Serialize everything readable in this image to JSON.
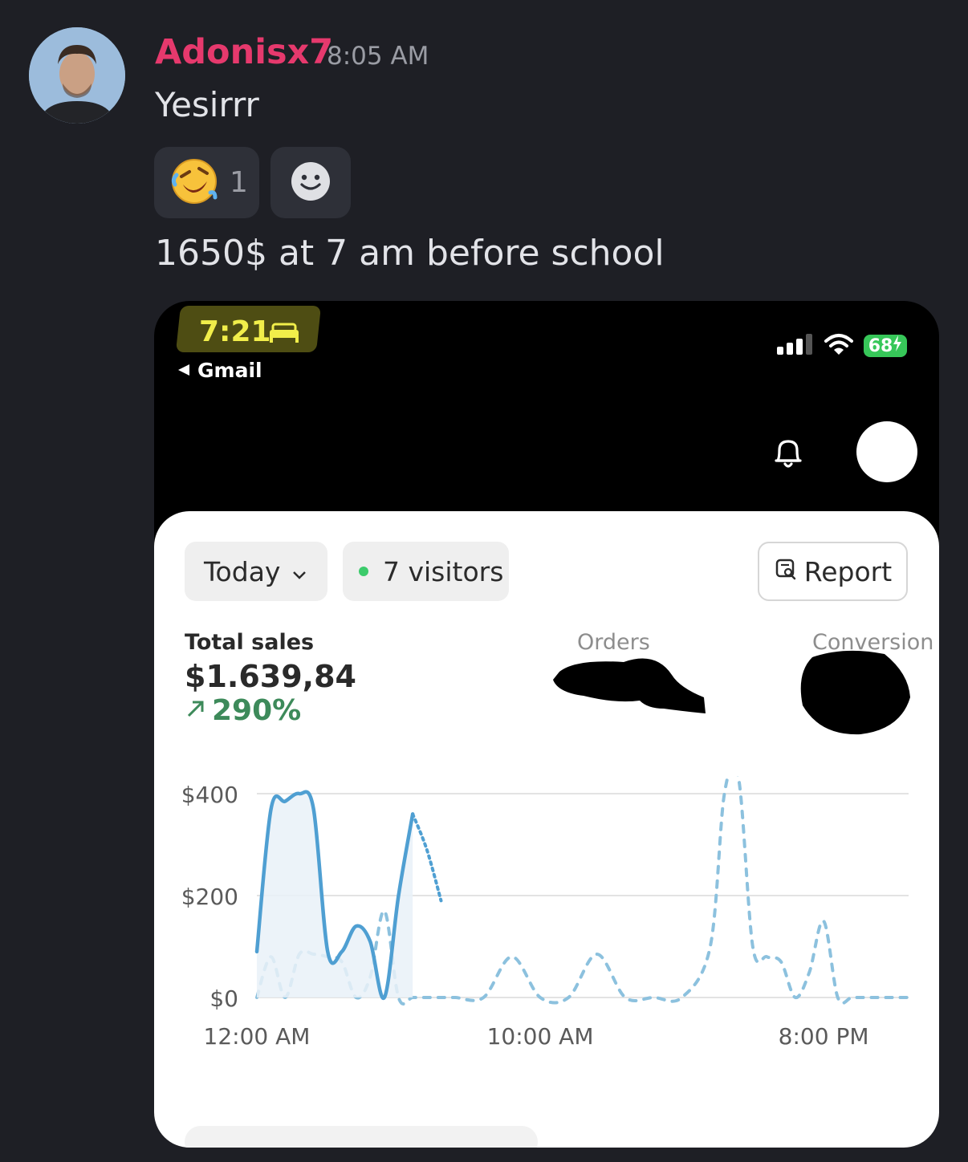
{
  "message": {
    "username": "Adonisx7",
    "timestamp": "8:05 AM",
    "text1": "Yesirrr",
    "reaction": {
      "emoji": "🤣",
      "count": "1"
    },
    "text2": "1650$ at 7 am before school"
  },
  "phone": {
    "time": "7:21",
    "back_label": "Gmail",
    "battery": "68"
  },
  "dashboard": {
    "period": "Today",
    "visitors": "7 visitors",
    "report": "Report",
    "total_sales_label": "Total sales",
    "total_sales_value": "$1.639,84",
    "total_sales_change": "290%",
    "orders_label": "Orders",
    "conversion_label": "Conversion"
  },
  "chart_data": {
    "type": "line",
    "y_ticks": [
      "$400",
      "$200",
      "$0"
    ],
    "x_ticks": [
      "12:00 AM",
      "10:00 AM",
      "8:00 PM"
    ],
    "ylim": [
      0,
      400
    ],
    "series": [
      {
        "style": "solid",
        "x_hours": [
          0,
          0.5,
          1,
          1.5,
          2,
          2.5,
          3,
          3.5,
          4,
          4.5,
          5,
          5.5,
          6,
          6.5
        ],
        "values": [
          90,
          370,
          385,
          400,
          370,
          90,
          90,
          140,
          110,
          0,
          200,
          360,
          290,
          190
        ]
      },
      {
        "style": "dashed",
        "x_hours": [
          0,
          0.5,
          1,
          1.5,
          2,
          2.5,
          3,
          3.5,
          4,
          4.5,
          5,
          5.5,
          6,
          6.5,
          7,
          8,
          9,
          10,
          11,
          12,
          13,
          14,
          15,
          16,
          16.5,
          17,
          17.5,
          18,
          18.5,
          19,
          19.5,
          20,
          20.5,
          21,
          21.5,
          22,
          22.5,
          23
        ],
        "values": [
          0,
          80,
          0,
          85,
          85,
          80,
          70,
          0,
          40,
          170,
          0,
          0,
          0,
          0,
          0,
          0,
          80,
          0,
          0,
          85,
          0,
          0,
          0,
          100,
          400,
          430,
          100,
          80,
          70,
          0,
          50,
          150,
          0,
          0,
          0,
          0,
          0,
          0
        ]
      }
    ]
  }
}
